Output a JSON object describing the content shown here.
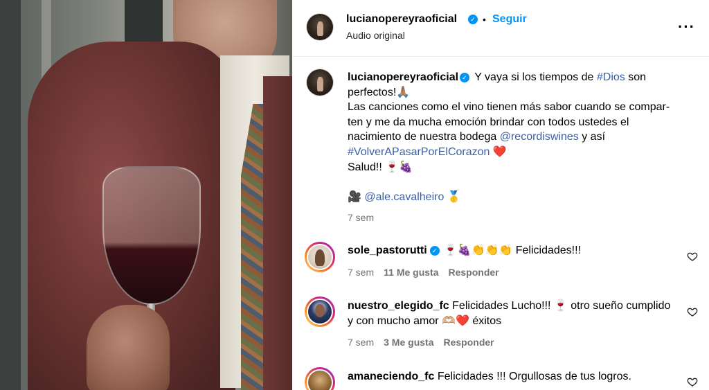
{
  "post": {
    "author": "lucianopereyraoficial",
    "follow_label": "Seguir",
    "separator": "•",
    "audio_label": "Audio original",
    "more_icon": "more-horizontal-icon",
    "verified_icon": "verified-badge-icon"
  },
  "caption": {
    "username": "lucianopereyraoficial",
    "lines": {
      "l1_pre": "Y vaya si los tiempos de ",
      "l1_tag": "#Dios",
      "l1_post": " son perfectos!🙏🏽",
      "l2": "Las canciones como el vino tienen más sabor cuando se compar­ten y me da mucha emoción brindar con todos ustedes el nacimiento de nuestra bodega ",
      "l2_mention": "@recordiswines",
      "l2_post": " y así ",
      "l2_tag": "#VolverAPasarPorElCorazon",
      "l2_end": " ❤️",
      "l3": "Salud!! 🍷🍇",
      "l4_pre": "🎥 ",
      "l4_mention": "@ale.cavalheiro",
      "l4_post": " 🥇"
    },
    "time": "7 sem"
  },
  "comments": [
    {
      "username": "sole_pastorutti",
      "text": "🍷🍇👏👏👏 Felicidades!!!",
      "time": "7 sem",
      "likes": "11 Me gusta",
      "reply": "Responder"
    },
    {
      "username": "nuestro_elegido_fc",
      "text": "Felicidades Lucho!!! 🍷 otro sueño cumplido y con mucho amor 🫶🏼❤️ éxitos",
      "time": "7 sem",
      "likes": "3 Me gusta",
      "reply": "Responder"
    },
    {
      "username": "amaneciendo_fc",
      "text": "Felicidades !!! Orgullosas de tus logros."
    }
  ],
  "colors": {
    "accent": "#0095f6",
    "link": "#385ea8",
    "muted": "#737373"
  }
}
